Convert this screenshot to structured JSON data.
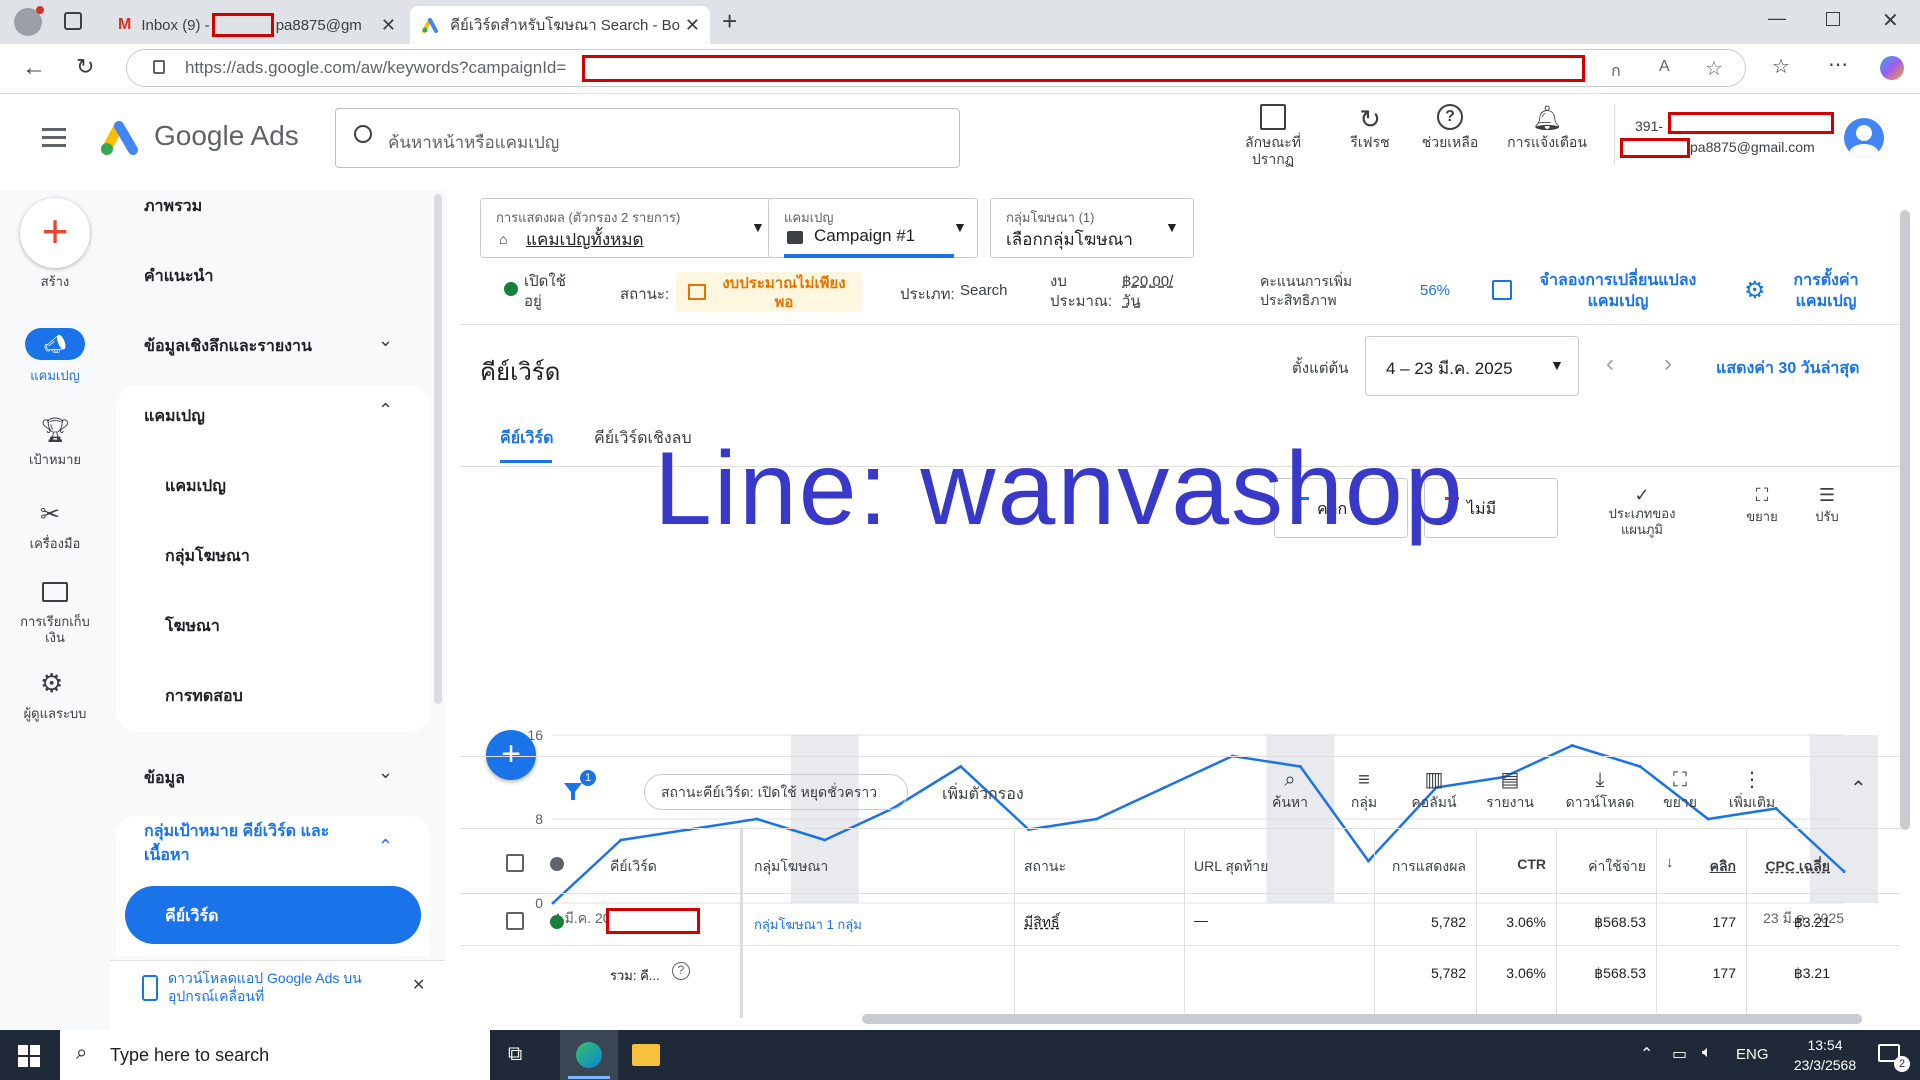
{
  "browser": {
    "tabs": [
      {
        "title": "Inbox (9) - ",
        "title_suffix": "pa8875@gm"
      },
      {
        "title": "คีย์เวิร์ดสำหรับโฆษณา Search - Bomb"
      }
    ],
    "url": "https://ads.google.com/aw/keywords?campaignId=",
    "read_aloud": "ออ"
  },
  "header": {
    "brand": "Google Ads",
    "search_placeholder": "ค้นหาหน้าหรือแคมเปญ",
    "appearance_label": "ลักษณะที่ปรากฏ",
    "refresh_label": "รีเฟรช",
    "help_label": "ช่วยเหลือ",
    "notifications_label": "การแจ้งเตือน",
    "account_id_prefix": "391-",
    "account_email_suffix": "pa8875@gmail.com"
  },
  "rail": {
    "create": "สร้าง",
    "campaigns": "แคมเปญ",
    "goals": "เป้าหมาย",
    "tools": "เครื่องมือ",
    "billing": "การเรียกเก็บเงิน",
    "admin": "ผู้ดูแลระบบ"
  },
  "nav": {
    "overview": "ภาพรวม",
    "recommendations": "คำแนะนำ",
    "insights": "ข้อมูลเชิงลึกและรายงาน",
    "campaigns_group": "แคมเปญ",
    "campaigns": "แคมเปญ",
    "ad_groups": "กลุ่มโฆษณา",
    "ads": "โฆษณา",
    "experiments": "การทดสอบ",
    "data": "ข้อมูล",
    "targeting_group": "กลุ่มเป้าหมาย คีย์เวิร์ด และเนื้อหา",
    "keywords": "คีย์เวิร์ด",
    "download_app": "ดาวน์โหลดแอป Google Ads บนอุปกรณ์เคลื่อนที่"
  },
  "filters": {
    "view_label": "การแสดงผล (ตัวกรอง 2 รายการ)",
    "view_value": "แคมเปญทั้งหมด",
    "campaign_label": "แคมเปญ",
    "campaign_value": "Campaign #1",
    "adgroup_label": "กลุ่มโฆษณา (1)",
    "adgroup_value": "เลือกกลุ่มโฆษณา"
  },
  "status_bar": {
    "enabled": "เปิดใช้อยู่",
    "status_label": "สถานะ:",
    "status_value": "งบประมาณไม่เพียงพอ",
    "type_label": "ประเภท:",
    "type_value": "Search",
    "budget_label": "งบประมาณ:",
    "budget_value": "฿20.00/วัน",
    "optimization_label": "คะแนนการเพิ่มประสิทธิภาพ",
    "optimization_value": "56%",
    "simulate": "จำลองการเปลี่ยนแปลงแคมเปญ",
    "settings": "การตั้งค่าแคมเปญ"
  },
  "page": {
    "title": "คีย์เวิร์ด",
    "date_prefix": "ตั้งแต่ต้น",
    "date_range": "4 – 23 มี.ค. 2025",
    "show_last": "แสดงค่า 30 วันล่าสุด",
    "tab_keywords": "คีย์เวิร์ด",
    "tab_negative": "คีย์เวิร์ดเชิงลบ"
  },
  "watermark": "Line:  wanvashop",
  "chart_controls": {
    "metric1": "คลิก",
    "metric2": "ไม่มี",
    "type": "ประเภทของแผนภูมิ",
    "expand": "ขยาย",
    "adjust": "ปรับ"
  },
  "chart_data": {
    "type": "line",
    "x": [
      "4 มี.ค. 2025",
      "5",
      "6",
      "7",
      "8",
      "9",
      "10",
      "11",
      "12",
      "13",
      "14",
      "15",
      "16",
      "17",
      "18",
      "19",
      "20",
      "21",
      "22",
      "23 มี.ค. 2025"
    ],
    "x_tick_labels": [
      "4 มี.ค. 2025",
      "23 มี.ค. 2025"
    ],
    "series": [
      {
        "values": [
          0,
          6,
          7,
          8,
          6,
          9,
          13,
          7,
          8,
          11,
          14,
          13,
          4,
          11,
          12,
          15,
          13,
          8,
          9,
          3
        ],
        "color": "#1a73e8"
      }
    ],
    "y_ticks": [
      0,
      8,
      16
    ],
    "ylim": [
      0,
      16
    ],
    "shaded_days": [
      4,
      11,
      19
    ]
  },
  "table_toolbar": {
    "filter_count": "1",
    "chip": "สถานะคีย์เวิร์ด: เปิดใช้ หยุดชั่วคราว",
    "add_filter": "เพิ่มตัวกรอง",
    "search": "ค้นหา",
    "segment": "กลุ่ม",
    "columns": "คอลัมน์",
    "reports": "รายงาน",
    "download": "ดาวน์โหลด",
    "expand": "ขยาย",
    "more": "เพิ่มเติม"
  },
  "table": {
    "headers": [
      "คีย์เวิร์ด",
      "กลุ่มโฆษณา",
      "สถานะ",
      "URL สุดท้าย",
      "การแสดงผล",
      "CTR",
      "ค่าใช้จ่าย",
      "คลิก",
      "CPC เฉลี่ย"
    ],
    "row": {
      "adgroup": "กลุ่มโฆษณา 1 กลุ่ม",
      "status": "มีสิทธิ์",
      "url": "—",
      "impressions": "5,782",
      "ctr": "3.06%",
      "cost": "฿568.53",
      "clicks": "177",
      "cpc": "฿3.21"
    },
    "total": {
      "label": "รวม: คี...",
      "impressions": "5,782",
      "ctr": "3.06%",
      "cost": "฿568.53",
      "clicks": "177",
      "cpc": "฿3.21"
    }
  },
  "taskbar": {
    "search_placeholder": "Type here to search",
    "lang": "ENG",
    "time": "13:54",
    "date": "23/3/2568",
    "notif_count": "2"
  }
}
